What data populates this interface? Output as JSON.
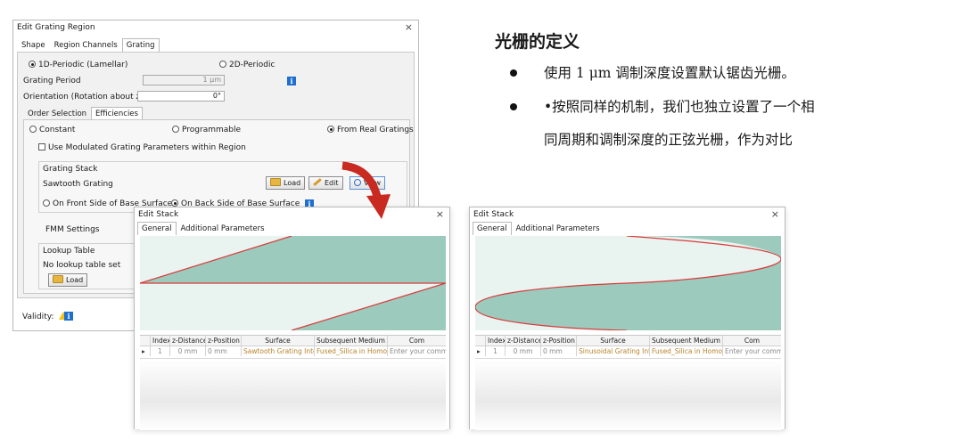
{
  "main_dialog": {
    "title": "Edit Grating Region",
    "close": "×",
    "tabs": [
      "Shape",
      "Region Channels",
      "Grating"
    ],
    "periodic_1d": "1D-Periodic (Lamellar)",
    "periodic_2d": "2D-Periodic",
    "grating_period_label": "Grating Period",
    "grating_period_value": "1 µm",
    "orientation_label": "Orientation (Rotation about z-Axis)",
    "orientation_value": "0°",
    "sub_tabs": [
      "Order Selection",
      "Efficiencies"
    ],
    "opt_constant": "Constant",
    "opt_programmable": "Programmable",
    "opt_real": "From Real Gratings",
    "use_modulated": "Use Modulated Grating Parameters within Region",
    "grating_stack_label": "Grating Stack",
    "sawtooth_label": "Sawtooth Grating",
    "load": "Load",
    "edit": "Edit",
    "view": "View",
    "front_side": "On Front Side of Base Surface",
    "back_side": "On Back Side of Base Surface",
    "fmm_settings": "FMM Settings",
    "lookup_label": "Lookup Table",
    "no_lookup": "No lookup table set",
    "lookup_load": "Load",
    "validity": "Validity:",
    "info": "i"
  },
  "edit_stack_left": {
    "title": "Edit Stack",
    "close": "×",
    "tabs": [
      "General",
      "Additional Parameters"
    ],
    "table_headers": [
      "",
      "Index",
      "z-Distance",
      "z-Position",
      "Surface",
      "Subsequent Medium",
      "Com"
    ],
    "row": [
      "▸",
      "1",
      "0 mm",
      "0 mm",
      "Sawtooth Grating Inte",
      "Fused_Silica in Homog",
      "Enter your commen"
    ]
  },
  "edit_stack_right": {
    "title": "Edit Stack",
    "close": "×",
    "tabs": [
      "General",
      "Additional Parameters"
    ],
    "table_headers": [
      "",
      "Index",
      "z-Distance",
      "z-Position",
      "Surface",
      "Subsequent Medium",
      "Com"
    ],
    "row": [
      "▸",
      "1",
      "0 mm",
      "0 mm",
      "Sinusoidal Grating Inte",
      "Fused_Silica in Homog",
      "Enter your commen"
    ]
  },
  "notes": {
    "heading": "光栅的定义",
    "bullet1": "使用 1 μm 调制深度设置默认锯齿光栅。",
    "bullet2_line1": "•按照同样的机制，我们也独立设置了一个相",
    "bullet2_line2": "同周期和调制深度的正弦光栅，作为对比"
  },
  "colors": {
    "material": "#9ccbbd",
    "air": "#e9f4f1",
    "profile": "#d93a3a",
    "arrow": "#c82a21",
    "accent": "#1e6fd0"
  },
  "icons": [
    "close-icon",
    "folder-icon",
    "pencil-icon",
    "magnifier-icon",
    "warning-icon",
    "info-icon",
    "red-arrow-icon"
  ]
}
